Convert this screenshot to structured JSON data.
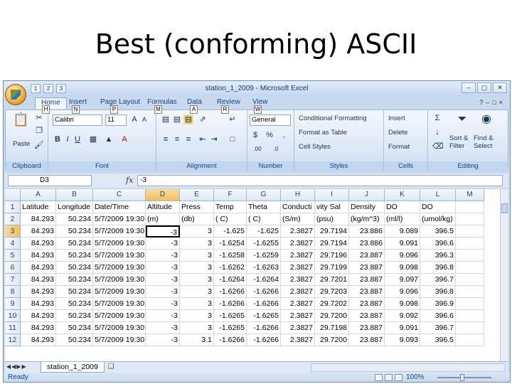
{
  "slide": {
    "title": "Best (conforming) ASCII"
  },
  "window": {
    "title": "station_1_2009 - Microsoft Excel",
    "qat_keytips": [
      "1",
      "2",
      "3"
    ],
    "controls": [
      "–",
      "▢",
      "✕"
    ]
  },
  "tabs": [
    {
      "label": "Home",
      "keytip": "H",
      "active": true
    },
    {
      "label": "Insert",
      "keytip": "N"
    },
    {
      "label": "Page Layout",
      "keytip": "P"
    },
    {
      "label": "Formulas",
      "keytip": "M"
    },
    {
      "label": "Data",
      "keytip": "A"
    },
    {
      "label": "Review",
      "keytip": "R"
    },
    {
      "label": "View",
      "keytip": "W"
    }
  ],
  "ribbon": {
    "clipboard": {
      "label": "Clipboard",
      "paste": "Paste"
    },
    "font": {
      "label": "Font",
      "name": "Calibri",
      "size": "11",
      "bold": "B",
      "italic": "I",
      "underline": "U"
    },
    "alignment": {
      "label": "Alignment"
    },
    "number": {
      "label": "Number",
      "format": "General",
      "currency": "$",
      "percent": "%",
      "comma": ",",
      "inc": ".00",
      "dec": ".0"
    },
    "styles": {
      "label": "Styles",
      "conditional": "Conditional Formatting",
      "format_table": "Format as Table",
      "cell_styles": "Cell Styles"
    },
    "cells": {
      "label": "Cells",
      "insert": "Insert",
      "delete": "Delete",
      "format": "Format"
    },
    "editing": {
      "label": "Editing",
      "sort": "Sort &",
      "filter": "Filter",
      "find": "Find &",
      "select": "Select"
    }
  },
  "formula_bar": {
    "name_box": "D3",
    "fx": "fx",
    "value": "-3"
  },
  "columns": [
    "A",
    "B",
    "C",
    "D",
    "E",
    "F",
    "G",
    "H",
    "I",
    "J",
    "K",
    "L",
    "M"
  ],
  "rows": [
    [
      "Latitude",
      "Longitude",
      "Date/Time",
      "Altitude",
      "Press",
      "Temp",
      "Theta",
      "Conducti",
      "vity Sal",
      "Density",
      "DO",
      "DO",
      ""
    ],
    [
      "84.293",
      "50.234",
      "5/7/2009 19:30",
      "(m)",
      "(db)",
      "( C)",
      "( C)",
      "(S/m)",
      "(psu)",
      "(kg/m^3)",
      "(ml/l)",
      "(umol/kg)",
      ""
    ],
    [
      "84.293",
      "50.234",
      "5/7/2009 19:30",
      "-3",
      "3",
      "-1.625",
      "-1.625",
      "2.3827",
      "29.7194",
      "23.886",
      "9.089",
      "396.5",
      ""
    ],
    [
      "84.293",
      "50.234",
      "5/7/2009 19:30",
      "-3",
      "3",
      "-1.6254",
      "-1.6255",
      "2.3827",
      "29.7194",
      "23.886",
      "9.091",
      "396.6",
      ""
    ],
    [
      "84.293",
      "50.234",
      "5/7/2009 19:30",
      "-3",
      "3",
      "-1.6258",
      "-1.6259",
      "2.3827",
      "29.7196",
      "23.887",
      "9.096",
      "396.3",
      ""
    ],
    [
      "84.293",
      "50.234",
      "5/7/2009 19:30",
      "-3",
      "3",
      "-1.6262",
      "-1.6263",
      "2.3827",
      "29.7199",
      "23.887",
      "9.098",
      "396.8",
      ""
    ],
    [
      "84.293",
      "50.234",
      "5/7/2009 19:30",
      "-3",
      "3",
      "-1.6264",
      "-1.6264",
      "2.3827",
      "29.7201",
      "23.887",
      "9.097",
      "396.7",
      ""
    ],
    [
      "84.293",
      "50.234",
      "5/7/2009 19:30",
      "-3",
      "3",
      "-1.6266",
      "-1.6266",
      "2.3827",
      "29.7203",
      "23.887",
      "9.096",
      "396.8",
      ""
    ],
    [
      "84.293",
      "50.234",
      "5/7/2009 19:30",
      "-3",
      "3",
      "-1.6266",
      "-1.6266",
      "2.3827",
      "29.7202",
      "23.887",
      "9.098",
      "396.9",
      ""
    ],
    [
      "84.293",
      "50.234",
      "5/7/2009 19:30",
      "-3",
      "3",
      "-1.6265",
      "-1.6265",
      "2.3827",
      "29.7200",
      "23.887",
      "9.092",
      "396.6",
      ""
    ],
    [
      "84.293",
      "50.234",
      "5/7/2009 19:30",
      "-3",
      "3",
      "-1.6265",
      "-1.6266",
      "2.3827",
      "29.7198",
      "23.887",
      "9.091",
      "396.7",
      ""
    ],
    [
      "84.293",
      "50.234",
      "5/7/2009 19:30",
      "-3",
      "3.1",
      "-1.6266",
      "-1.6266",
      "2.3827",
      "29.7200",
      "23.887",
      "9.093",
      "396.5",
      ""
    ]
  ],
  "active_cell": {
    "row": 3,
    "col": "D"
  },
  "sheet": {
    "tab": "station_1_2009"
  },
  "status": {
    "ready": "Ready",
    "zoom": "100%"
  }
}
